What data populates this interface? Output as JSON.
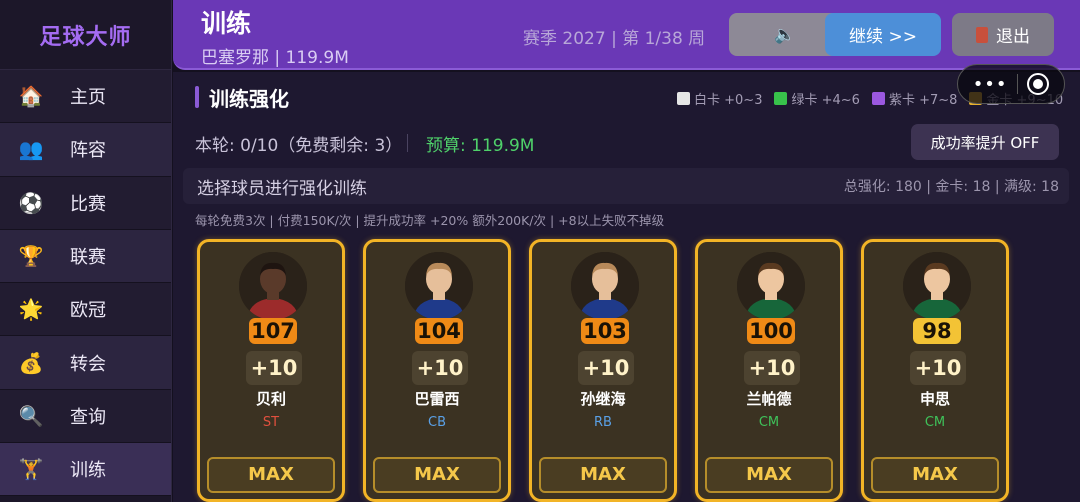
{
  "app": {
    "logo": "足球大师"
  },
  "sidebar": {
    "items": [
      {
        "icon": "🏠",
        "icon_name": "home-icon",
        "label": "主页"
      },
      {
        "icon": "👥",
        "icon_name": "squad-icon",
        "label": "阵容"
      },
      {
        "icon": "⚽",
        "icon_name": "soccer-ball-icon",
        "label": "比赛"
      },
      {
        "icon": "🏆",
        "icon_name": "trophy-icon",
        "label": "联赛"
      },
      {
        "icon": "🌟",
        "icon_name": "star-icon",
        "label": "欧冠"
      },
      {
        "icon": "💰",
        "icon_name": "money-bag-icon",
        "label": "转会"
      },
      {
        "icon": "🔍",
        "icon_name": "search-icon",
        "label": "查询"
      },
      {
        "icon": "🏋",
        "icon_name": "training-icon",
        "label": "训练"
      }
    ],
    "active_index": 7
  },
  "header": {
    "title": "训练",
    "subtitle": "巴塞罗那 | 119.9M",
    "season": "赛季 2027 | 第 1/38 周",
    "sound_icon": "🔈",
    "continue_label": "继续  >>",
    "exit_label": "退出"
  },
  "main": {
    "section_title": "训练强化",
    "legend": [
      {
        "label": "白卡 +0~3",
        "color": "#e6e6e6"
      },
      {
        "label": "绿卡 +4~6",
        "color": "#38c24b"
      },
      {
        "label": "紫卡 +7~8",
        "color": "#9b58e0"
      },
      {
        "label": "金卡 +9~10",
        "color": "#e8b12c"
      }
    ],
    "round_info": "本轮: 0/10（免费剩余: 3）",
    "budget": "预算: 119.9M",
    "rate_button": "成功率提升 OFF",
    "select_title": "选择球员进行强化训练",
    "stats": "总强化: 180 | 金卡: 18 | 满级: 18",
    "rule_text": "每轮免费3次 | 付费150K/次 | 提升成功率 +20% 额外200K/次 | +8以上失败不掉级"
  },
  "players": [
    {
      "rating": "107",
      "bonus": "+10",
      "name": "贝利",
      "position": "ST",
      "pos_color": "#e0503e",
      "kit": "#9c2b2b",
      "skin": "#5a3a2a",
      "hair": "#1e1410",
      "action": "MAX"
    },
    {
      "rating": "104",
      "bonus": "+10",
      "name": "巴雷西",
      "position": "CB",
      "pos_color": "#5aa0e6",
      "kit": "#1f3a8a",
      "skin": "#e6bf9a",
      "hair": "#b88a5a",
      "action": "MAX"
    },
    {
      "rating": "103",
      "bonus": "+10",
      "name": "孙继海",
      "position": "RB",
      "pos_color": "#5aa0e6",
      "kit": "#1f3a8a",
      "skin": "#e6bf9a",
      "hair": "#b88a5a",
      "action": "MAX"
    },
    {
      "rating": "100",
      "bonus": "+10",
      "name": "兰帕德",
      "position": "CM",
      "pos_color": "#3fc25a",
      "kit": "#17663a",
      "skin": "#edc6a0",
      "hair": "#5a3a20",
      "action": "MAX"
    },
    {
      "rating": "98",
      "bonus": "+10",
      "name": "申思",
      "position": "CM",
      "pos_color": "#3fc25a",
      "kit": "#17663a",
      "skin": "#edc6a0",
      "hair": "#5a3a20",
      "action": "MAX"
    }
  ]
}
